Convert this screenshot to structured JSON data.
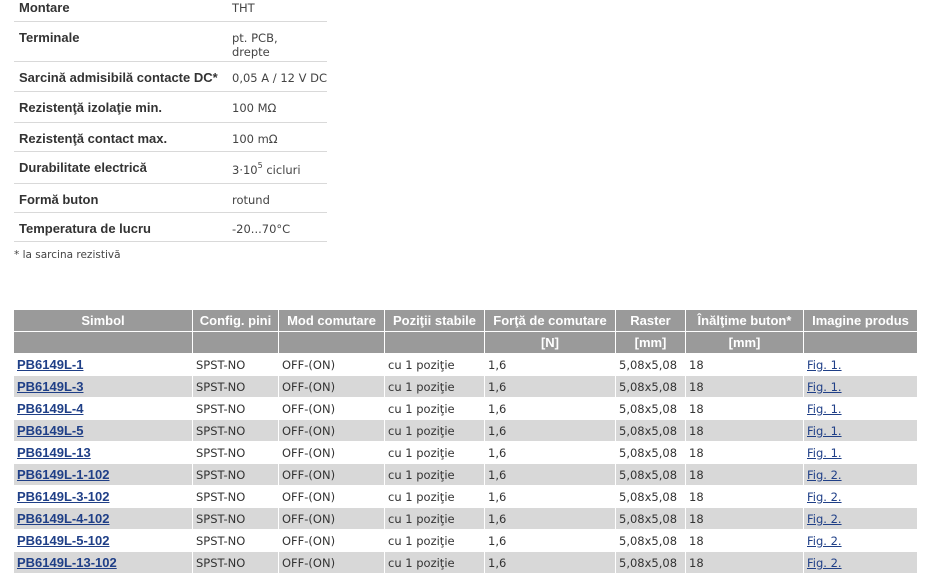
{
  "specs": [
    {
      "key": "Montare",
      "value": "THT"
    },
    {
      "key": "Terminale",
      "value_lines": [
        "pt. PCB,",
        "drepte"
      ]
    },
    {
      "key": "Sarcină admisibilă contacte DC*",
      "value": "0,05 A / 12 V DC"
    },
    {
      "key": "Rezistenţă izolaţie min.",
      "value": "100 MΩ"
    },
    {
      "key": "Rezistenţă contact max.",
      "value": "100 mΩ"
    },
    {
      "key": "Durabilitate electrică",
      "value_base": "3·10",
      "value_exp": "5",
      "value_rest": " cicluri"
    },
    {
      "key": "Formă buton",
      "value": "rotund"
    },
    {
      "key": "Temperatura de lucru",
      "value": "-20...70°C"
    }
  ],
  "footnote": "* la sarcina rezistivă",
  "product_table": {
    "headers": [
      "Simbol",
      "Config. pini",
      "Mod comutare",
      "Poziţii stabile",
      "Forţă de comutare",
      "Raster",
      "Înălţime buton*",
      "Imagine produs"
    ],
    "units": [
      "",
      "",
      "",
      "",
      "[N]",
      "[mm]",
      "[mm]",
      ""
    ],
    "rows": [
      [
        "PB6149L-1",
        "SPST-NO",
        "OFF-(ON)",
        "cu 1 poziţie",
        "1,6",
        "5,08x5,08",
        "18",
        "Fig. 1."
      ],
      [
        "PB6149L-3",
        "SPST-NO",
        "OFF-(ON)",
        "cu 1 poziţie",
        "1,6",
        "5,08x5,08",
        "18",
        "Fig. 1."
      ],
      [
        "PB6149L-4",
        "SPST-NO",
        "OFF-(ON)",
        "cu 1 poziţie",
        "1,6",
        "5,08x5,08",
        "18",
        "Fig. 1."
      ],
      [
        "PB6149L-5",
        "SPST-NO",
        "OFF-(ON)",
        "cu 1 poziţie",
        "1,6",
        "5,08x5,08",
        "18",
        "Fig. 1."
      ],
      [
        "PB6149L-13",
        "SPST-NO",
        "OFF-(ON)",
        "cu 1 poziţie",
        "1,6",
        "5,08x5,08",
        "18",
        "Fig. 1."
      ],
      [
        "PB6149L-1-102",
        "SPST-NO",
        "OFF-(ON)",
        "cu 1 poziţie",
        "1,6",
        "5,08x5,08",
        "18",
        "Fig. 2."
      ],
      [
        "PB6149L-3-102",
        "SPST-NO",
        "OFF-(ON)",
        "cu 1 poziţie",
        "1,6",
        "5,08x5,08",
        "18",
        "Fig. 2."
      ],
      [
        "PB6149L-4-102",
        "SPST-NO",
        "OFF-(ON)",
        "cu 1 poziţie",
        "1,6",
        "5,08x5,08",
        "18",
        "Fig. 2."
      ],
      [
        "PB6149L-5-102",
        "SPST-NO",
        "OFF-(ON)",
        "cu 1 poziţie",
        "1,6",
        "5,08x5,08",
        "18",
        "Fig. 2."
      ],
      [
        "PB6149L-13-102",
        "SPST-NO",
        "OFF-(ON)",
        "cu 1 poziţie",
        "1,6",
        "5,08x5,08",
        "18",
        "Fig. 2."
      ]
    ]
  },
  "colors": {
    "header_bg": "#9a9a9a",
    "row_alt_bg": "#d8d8d8",
    "link": "#1f3f87"
  }
}
